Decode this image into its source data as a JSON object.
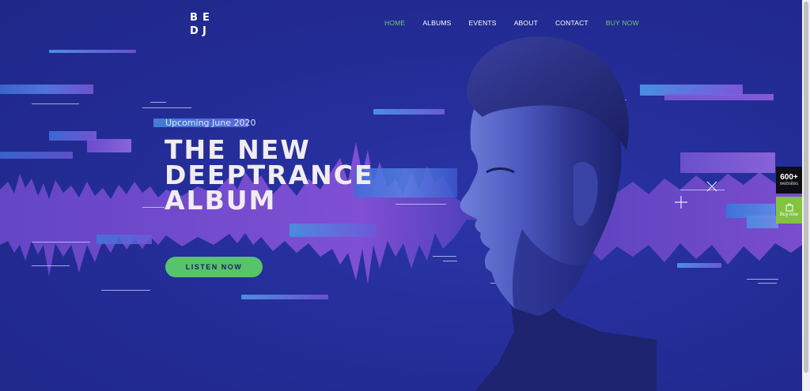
{
  "logo": {
    "letters": [
      "B",
      "E",
      "D",
      "J"
    ]
  },
  "nav": {
    "home": "HOME",
    "albums": "ALBUMS",
    "events": "EVENTS",
    "about": "ABOUT",
    "contact": "CONTACT",
    "buy": "BUY NOW"
  },
  "hero": {
    "kicker": "Upcoming June 2020",
    "title_lines": [
      "THE NEW",
      "DEEPTRANCE",
      "ALBUM"
    ],
    "cta": "LISTEN NOW"
  },
  "widgets": {
    "sites_count": "600+",
    "sites_label": "websites",
    "buy_label": "Buy now"
  },
  "colors": {
    "background": "#232c95",
    "accent_green": "#57c46c",
    "nav_active": "#6ec77a",
    "wave_purple": "#8a52d8",
    "streak_blue": "#4a8fe0"
  },
  "icons": [
    "shopping-bag-icon",
    "close-x-icon",
    "plus-icon"
  ]
}
